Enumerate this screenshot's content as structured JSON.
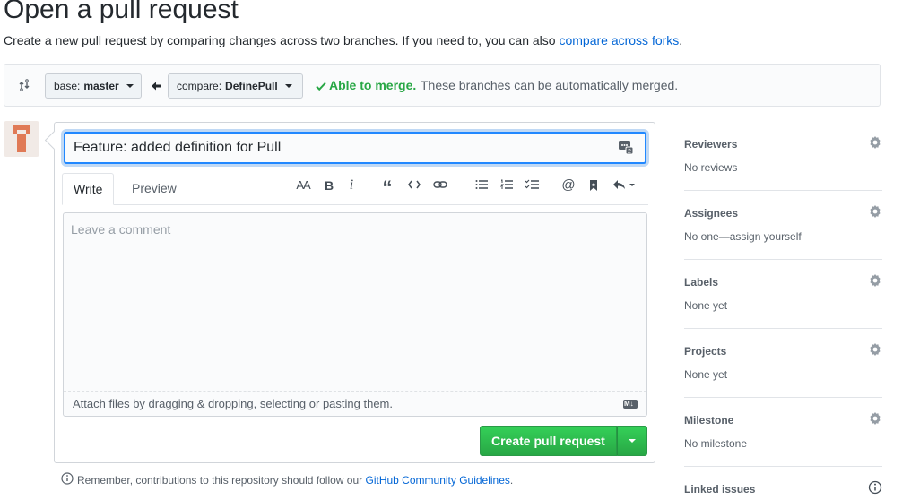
{
  "page": {
    "title": "Open a pull request",
    "subtitle": "Create a new pull request by comparing changes across two branches. If you need to, you can also ",
    "subtitle_link": "compare across forks",
    "subtitle_end": "."
  },
  "compare": {
    "base_prefix": "base:",
    "base_branch": "master",
    "compare_prefix": "compare:",
    "compare_branch": "DefinePull",
    "merge_status": "Able to merge.",
    "merge_message": "These branches can be automatically merged."
  },
  "form": {
    "title_value": "Feature: added definition for Pull",
    "tabs": [
      "Write",
      "Preview"
    ],
    "toolbar": [
      "text-size-icon",
      "bold-icon",
      "italic-icon",
      "quote-icon",
      "code-icon",
      "link-icon",
      "bulleted-list-icon",
      "numbered-list-icon",
      "task-list-icon",
      "mention-icon",
      "saved-reply-icon",
      "reply-icon"
    ],
    "comment_placeholder": "Leave a comment",
    "attach_text": "Attach files by dragging & dropping, selecting or pasting them.",
    "submit_label": "Create pull request",
    "guidelines_prefix": "Remember, contributions to this repository should follow our ",
    "guidelines_link": "GitHub Community Guidelines",
    "guidelines_end": "."
  },
  "sidebar": {
    "items": [
      {
        "heading": "Reviewers",
        "value": "No reviews"
      },
      {
        "heading": "Assignees",
        "value": "No one—assign yourself"
      },
      {
        "heading": "Labels",
        "value": "None yet"
      },
      {
        "heading": "Projects",
        "value": "None yet"
      },
      {
        "heading": "Milestone",
        "value": "No milestone"
      },
      {
        "heading": "Linked issues",
        "value": ""
      }
    ]
  },
  "colors": {
    "accent": "#0366d6",
    "success": "#28a745",
    "focus": "#2188ff"
  }
}
